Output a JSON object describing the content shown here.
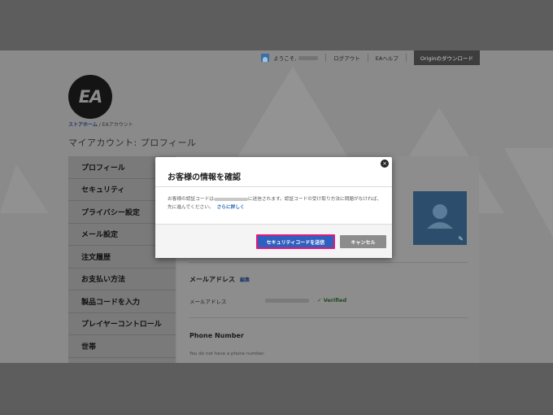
{
  "topbar": {
    "welcome": "ようこそ,",
    "logout": "ログアウト",
    "help": "EAヘルプ",
    "download": "Originのダウンロード"
  },
  "brand": {
    "logo_text": "EA"
  },
  "breadcrumb": {
    "home": "ストアホーム",
    "separator": " / ",
    "current": "EAアカウント"
  },
  "page_title": "マイアカウント: プロフィール",
  "sidebar": {
    "items": [
      {
        "label": "プロフィール"
      },
      {
        "label": "セキュリティ"
      },
      {
        "label": "プライバシー設定"
      },
      {
        "label": "メール設定"
      },
      {
        "label": "注文履歴"
      },
      {
        "label": "お支払い方法"
      },
      {
        "label": "製品コードを入力"
      },
      {
        "label": "プレイヤーコントロール"
      },
      {
        "label": "世帯"
      }
    ]
  },
  "content": {
    "email_section_title": "メールアドレス",
    "email_edit": "編集",
    "email_label": "メールアドレス",
    "verified": "✓ Verified",
    "phone_section_title": "Phone Number",
    "no_phone": "You do not have a phone number."
  },
  "modal": {
    "close": "×",
    "title": "お客様の情報を確認",
    "body_part1": "お客様の認証コードは",
    "body_part2": "に送信されます。認証コードの受け取り方法に問題がなければ、先に進んでください。",
    "more_link": "さらに詳しく",
    "send_button": "セキュリティコードを送信",
    "cancel_button": "キャンセル"
  },
  "colors": {
    "primary_button": "#2f5fbf",
    "highlight_border": "#e2197c",
    "link": "#2b6cb8"
  }
}
